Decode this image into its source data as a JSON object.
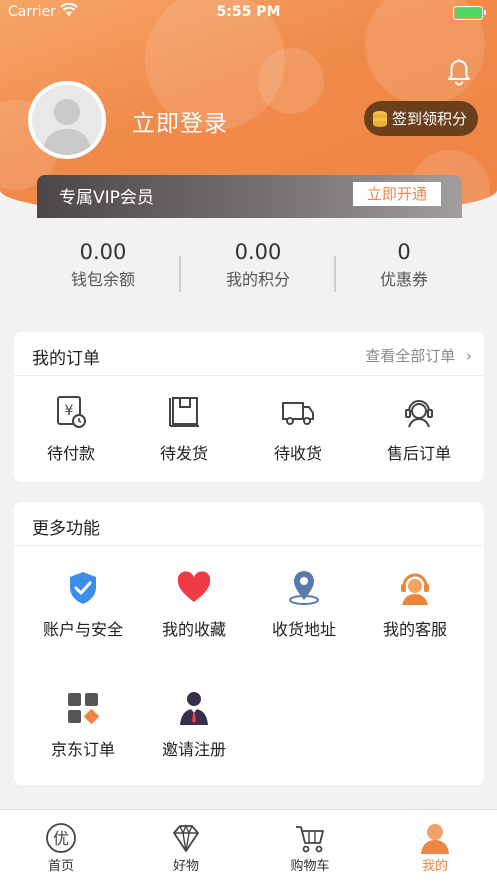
{
  "status_bar": {
    "carrier": "Carrier",
    "time": "5:55 PM"
  },
  "header": {
    "login_label": "立即登录",
    "checkin_label": "签到领积分"
  },
  "vip": {
    "label": "专属VIP会员",
    "open_button": "立即开通"
  },
  "stats": [
    {
      "value": "0.00",
      "label": "钱包余额"
    },
    {
      "value": "0.00",
      "label": "我的积分"
    },
    {
      "value": "0",
      "label": "优惠券"
    }
  ],
  "orders": {
    "title": "我的订单",
    "view_all": "查看全部订单",
    "items": [
      {
        "label": "待付款",
        "icon": "payment-pending-icon"
      },
      {
        "label": "待发货",
        "icon": "package-icon"
      },
      {
        "label": "待收货",
        "icon": "truck-icon"
      },
      {
        "label": "售后订单",
        "icon": "customer-service-icon"
      }
    ]
  },
  "functions": {
    "title": "更多功能",
    "items": [
      {
        "label": "账户与安全",
        "icon": "shield-icon"
      },
      {
        "label": "我的收藏",
        "icon": "heart-icon"
      },
      {
        "label": "收货地址",
        "icon": "location-pin-icon"
      },
      {
        "label": "我的客服",
        "icon": "headset-icon"
      },
      {
        "label": "京东订单",
        "icon": "grid-apps-icon"
      },
      {
        "label": "邀请注册",
        "icon": "invite-person-icon"
      }
    ]
  },
  "tabbar": {
    "items": [
      {
        "label": "首页",
        "icon": "discount-icon"
      },
      {
        "label": "好物",
        "icon": "diamond-icon"
      },
      {
        "label": "购物车",
        "icon": "cart-icon"
      },
      {
        "label": "我的",
        "icon": "profile-icon"
      }
    ],
    "active_index": 3
  },
  "colors": {
    "accent": "#ee8446",
    "header_start": "#f6a568",
    "vip_bar": "#4b4748",
    "checkin_bg": "#6a3f1c",
    "battery": "#4cd964"
  }
}
